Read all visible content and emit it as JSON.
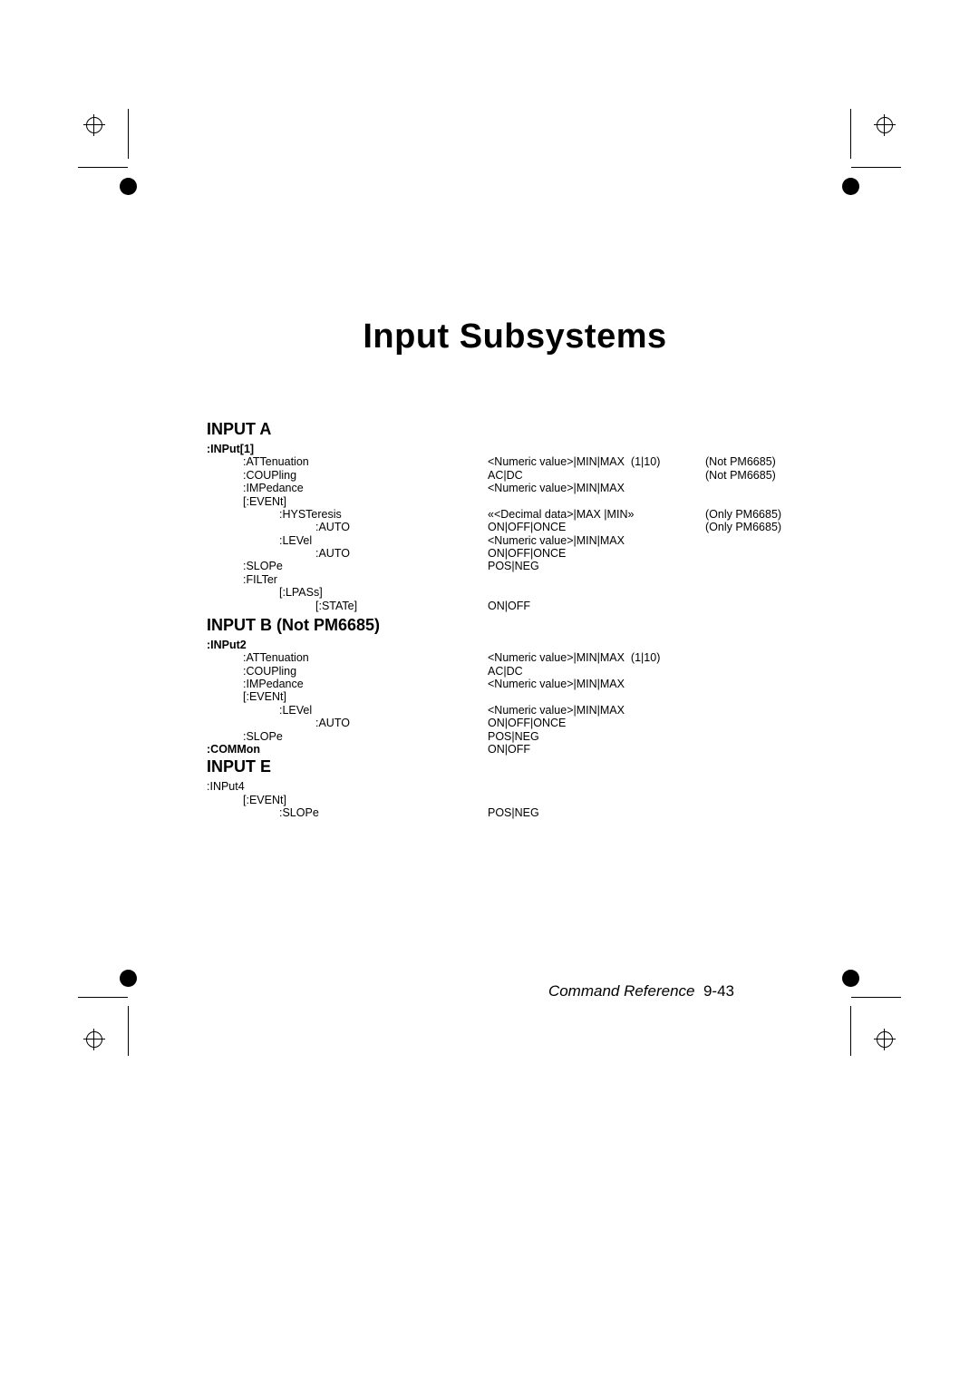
{
  "title": "Input Subsystems",
  "footer_text": "Command Reference",
  "footer_page": "9-43",
  "input_a": {
    "heading": "INPUT A",
    "root": ":INPut[1]",
    "rows": [
      {
        "c1": ":ATTenuation",
        "c4": "<Numeric value>|MIN|MAX  (1|10)",
        "c5": "(Not PM6685)"
      },
      {
        "c1": ":COUPling",
        "c4": "AC|DC",
        "c5": "(Not PM6685)"
      },
      {
        "c1": ":IMPedance",
        "c4": "<Numeric value>|MIN|MAX",
        "c5": ""
      },
      {
        "c1": "[:EVENt]",
        "c4": "",
        "c5": ""
      },
      {
        "c2": ":HYSTeresis",
        "c4": "«<Decimal data>|MAX |MIN»",
        "c5": "(Only PM6685)"
      },
      {
        "c3": ":AUTO",
        "c4": "ON|OFF|ONCE",
        "c5": "(Only PM6685)"
      },
      {
        "c2": ":LEVel",
        "c4": "<Numeric value>|MIN|MAX",
        "c5": ""
      },
      {
        "c3": ":AUTO",
        "c4": "ON|OFF|ONCE",
        "c5": ""
      },
      {
        "c1": ":SLOPe",
        "c4": "POS|NEG",
        "c5": ""
      },
      {
        "c1": ":FILTer",
        "c4": "",
        "c5": ""
      },
      {
        "c2": "[:LPASs]",
        "c4": "",
        "c5": ""
      },
      {
        "c3": "[:STATe]",
        "c4": "ON|OFF",
        "c5": ""
      }
    ]
  },
  "input_b": {
    "heading": "INPUT B (Not PM6685)",
    "root": ":INPut2",
    "rows": [
      {
        "c1": ":ATTenuation",
        "c4": "<Numeric value>|MIN|MAX  (1|10)",
        "c5": ""
      },
      {
        "c1": ":COUPling",
        "c4": "AC|DC",
        "c5": ""
      },
      {
        "c1": ":IMPedance",
        "c4": "<Numeric value>|MIN|MAX",
        "c5": ""
      },
      {
        "c1": "[:EVENt]",
        "c4": "",
        "c5": ""
      },
      {
        "c2": ":LEVel",
        "c4": "<Numeric value>|MIN|MAX",
        "c5": ""
      },
      {
        "c3": ":AUTO",
        "c4": "ON|OFF|ONCE",
        "c5": ""
      },
      {
        "c1": ":SLOPe",
        "c4": "POS|NEG",
        "c5": ""
      },
      {
        "c1b": ":COMMon",
        "c4": "ON|OFF",
        "c5": ""
      }
    ]
  },
  "input_e": {
    "heading": "INPUT E",
    "root": ":INPut4",
    "rows": [
      {
        "c1": "[:EVENt]",
        "c4": "",
        "c5": ""
      },
      {
        "c2": ":SLOPe",
        "c4": "POS|NEG",
        "c5": ""
      }
    ]
  }
}
